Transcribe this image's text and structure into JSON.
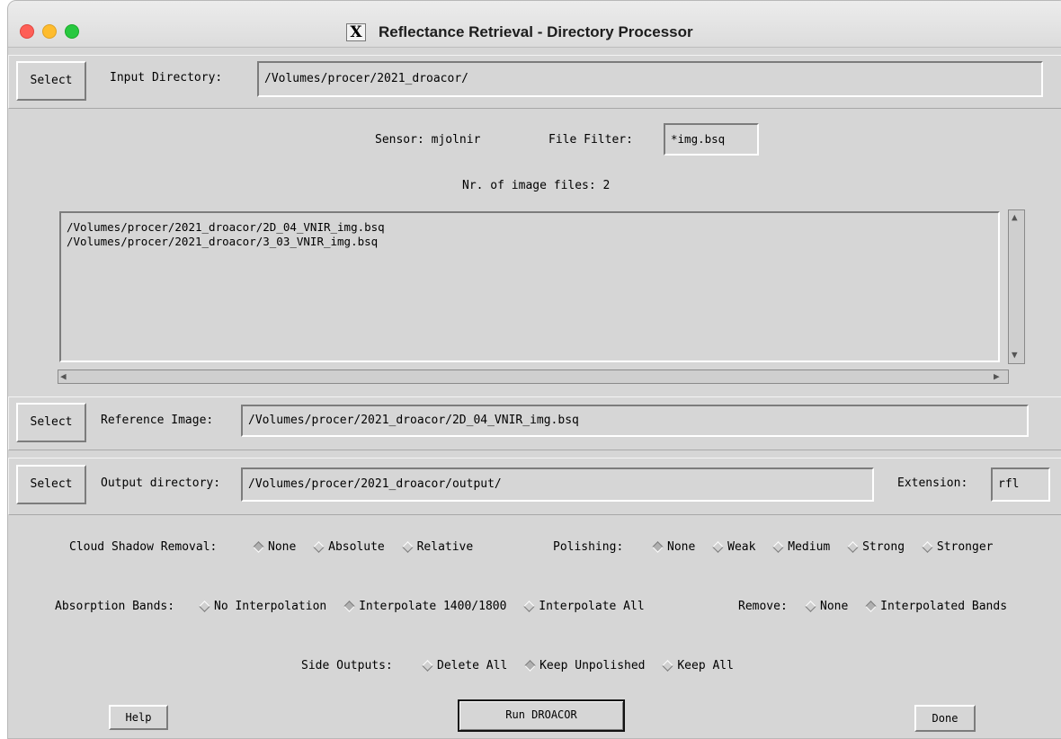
{
  "window": {
    "title": "Reflectance Retrieval - Directory Processor",
    "x_icon": "X"
  },
  "input": {
    "select_label": "Select",
    "label": "Input Directory:",
    "value": "/Volumes/procer/2021_droacor/"
  },
  "filter": {
    "sensor_text": "Sensor: mjolnir",
    "label": "File Filter:",
    "value": "*img.bsq",
    "count_text": "Nr. of image files: 2"
  },
  "file_list": [
    "/Volumes/procer/2021_droacor/2D_04_VNIR_img.bsq",
    "/Volumes/procer/2021_droacor/3_03_VNIR_img.bsq"
  ],
  "reference": {
    "select_label": "Select",
    "label": "Reference Image:",
    "value": "/Volumes/procer/2021_droacor/2D_04_VNIR_img.bsq"
  },
  "output": {
    "select_label": "Select",
    "label": "Output directory:",
    "value": "/Volumes/procer/2021_droacor/output/",
    "ext_label": "Extension:",
    "ext_value": "rfl"
  },
  "options": {
    "cloud_label": "Cloud Shadow Removal:",
    "cloud": [
      {
        "label": "None",
        "selected": true
      },
      {
        "label": "Absolute",
        "selected": false
      },
      {
        "label": "Relative",
        "selected": false
      }
    ],
    "polish_label": "Polishing:",
    "polish": [
      {
        "label": "None",
        "selected": true
      },
      {
        "label": "Weak",
        "selected": false
      },
      {
        "label": "Medium",
        "selected": false
      },
      {
        "label": "Strong",
        "selected": false
      },
      {
        "label": "Stronger",
        "selected": false
      }
    ],
    "absorption_label": "Absorption Bands:",
    "absorption": [
      {
        "label": "No Interpolation",
        "selected": false
      },
      {
        "label": "Interpolate 1400/1800",
        "selected": true
      },
      {
        "label": "Interpolate All",
        "selected": false
      }
    ],
    "remove_label": "Remove:",
    "remove": [
      {
        "label": "None",
        "selected": false
      },
      {
        "label": "Interpolated Bands",
        "selected": true
      }
    ],
    "side_label": "Side Outputs:",
    "side": [
      {
        "label": "Delete All",
        "selected": false
      },
      {
        "label": "Keep Unpolished",
        "selected": true
      },
      {
        "label": "Keep All",
        "selected": false
      }
    ]
  },
  "buttons": {
    "help": "Help",
    "run": "Run DROACOR",
    "done": "Done"
  }
}
